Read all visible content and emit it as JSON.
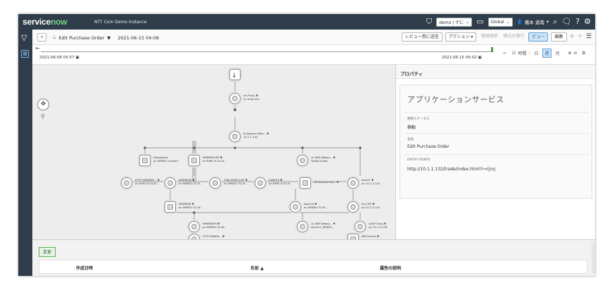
{
  "nav": {
    "brand": "servicenow",
    "brand_main": "service",
    "brand_accent": "now",
    "instance": "NTT Com Demo Instance",
    "domain_select": "demo | ゲに",
    "scope_select": "Global",
    "user": "橋本 道哉"
  },
  "header": {
    "title": "Edit Purchase Order",
    "caret": "▼",
    "date": "2021-06-15 04:08",
    "buttons": [
      "レビュー用に送信",
      "アクション",
      "侵続接続",
      "検点の実行",
      "ビュー",
      "編集"
    ]
  },
  "timeline": {
    "start": "2021-06-08 05:57",
    "end": "2021-06-15 05:02",
    "label_time": "時間",
    "opt_day": "日",
    "opt_week": "週",
    "opt_month": "月"
  },
  "nodes": [
    {
      "label": "",
      "l2": ""
    },
    {
      "label": "int Proxy ▼",
      "l2": "on hmp-xxx"
    },
    {
      "label": "Ib Apache Web... ▼",
      "l2": "10.1.1.132"
    },
    {
      "label": "Headspace",
      "l2": "on WINDO cluster1"
    },
    {
      "label": "WEBSRVVER ▼",
      "l2": "on RHEL 8-32-N..."
    },
    {
      "label": "1x IBM Websp... ▼",
      "l2": "TradeCluster"
    },
    {
      "label": "HTTP WEBSER... ▼",
      "l2": "on RHEL 8-32-N..."
    },
    {
      "label": "WEBSERV ▼",
      "l2": "on WINDO 32-N..."
    },
    {
      "label": "TVBLISHER EXE ▼",
      "l2": "on WINDO 32-N..."
    },
    {
      "label": "SAMPLE ▼",
      "l2": "on RHEL 8-32-N..."
    },
    {
      "label": "US Account Au... ▼",
      "l2": ""
    },
    {
      "label": "plane1 ▼",
      "l2": "on 10.1.2.141"
    },
    {
      "label": "WWEBSR ▼",
      "l2": "on WINDO 32-W..."
    },
    {
      "label": "Apache ▼",
      "l2": "on WINDO 32-N..."
    },
    {
      "label": "Sun JES ▼",
      "l2": "on 10.1.2.141"
    },
    {
      "label": "WWEBSVR ▼",
      "l2": "on WINDO 32-W..."
    },
    {
      "label": "1x IBM Websp... ▼",
      "l2": "server1_WINDO..."
    },
    {
      "label": "LDAP Sung ▼",
      "l2": "on 10.1.2.139"
    },
    {
      "label": "HTTP WWEB... ▼",
      "l2": ""
    },
    {
      "label": "IBM Server ▼",
      "l2": ""
    }
  ],
  "panel": {
    "heading": "プロパティ",
    "big": "アプリケーションサービス",
    "f1_label": "使用人テータス",
    "f1_value": "稼動",
    "f2_label": "名前",
    "f2_value": "Edit Purchase Order",
    "f3_label": "ENTRY POINTS",
    "f3_value": "http://10.1.1.132/trade/index.html?r=(jroj"
  },
  "bottom": {
    "tab": "変更",
    "col1": "作成日時",
    "col2": "名前 ▲",
    "col3": "属性の説明"
  }
}
